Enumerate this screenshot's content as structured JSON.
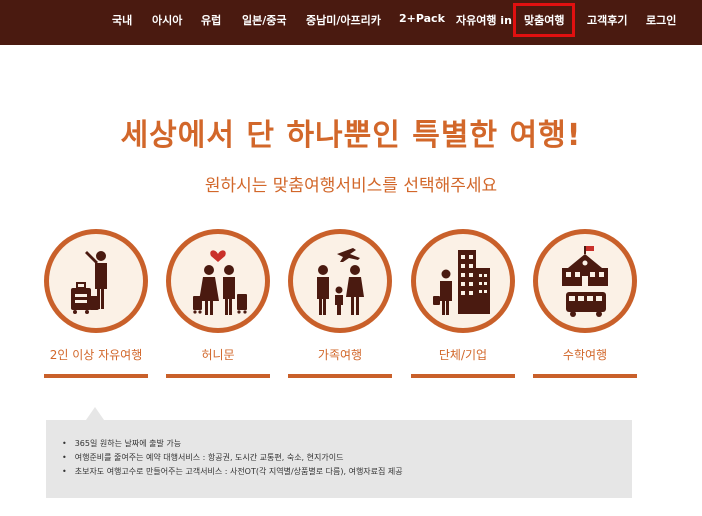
{
  "nav": {
    "items": [
      "국내",
      "아시아",
      "유럽",
      "일본/중국",
      "중남미/아프리카",
      "2+Pack",
      "자유여행 in",
      "맞춤여행",
      "고객후기",
      "로그인"
    ],
    "active_index": 7
  },
  "hero": {
    "title": "세상에서 단 하나뿐인 특별한 여행!",
    "subtitle": "원하시는 맞춤여행서비스를 선택해주세요"
  },
  "services": [
    {
      "label": "2인 이상 자유여행",
      "icon": "traveler-luggage-icon"
    },
    {
      "label": "허니문",
      "icon": "couple-heart-icon"
    },
    {
      "label": "가족여행",
      "icon": "family-airplane-icon"
    },
    {
      "label": "단체/기업",
      "icon": "business-buildings-icon"
    },
    {
      "label": "수학여행",
      "icon": "school-bus-icon"
    }
  ],
  "info": {
    "bullets": [
      "365일 원하는 날짜에 출발 가능",
      "여행준비를 줄여주는 예약 대행서비스 : 항공권, 도시간 교통편, 숙소, 현지가이드",
      "초보자도 여행고수로 만들어주는 고객서비스 : 사전OT(각 지역별/상품별로 다름), 여행자료집 제공"
    ]
  },
  "colors": {
    "topbar": "#4a1a10",
    "accent": "#d2672a",
    "highlight": "#e01010",
    "info_bg": "#e6e6e6"
  }
}
